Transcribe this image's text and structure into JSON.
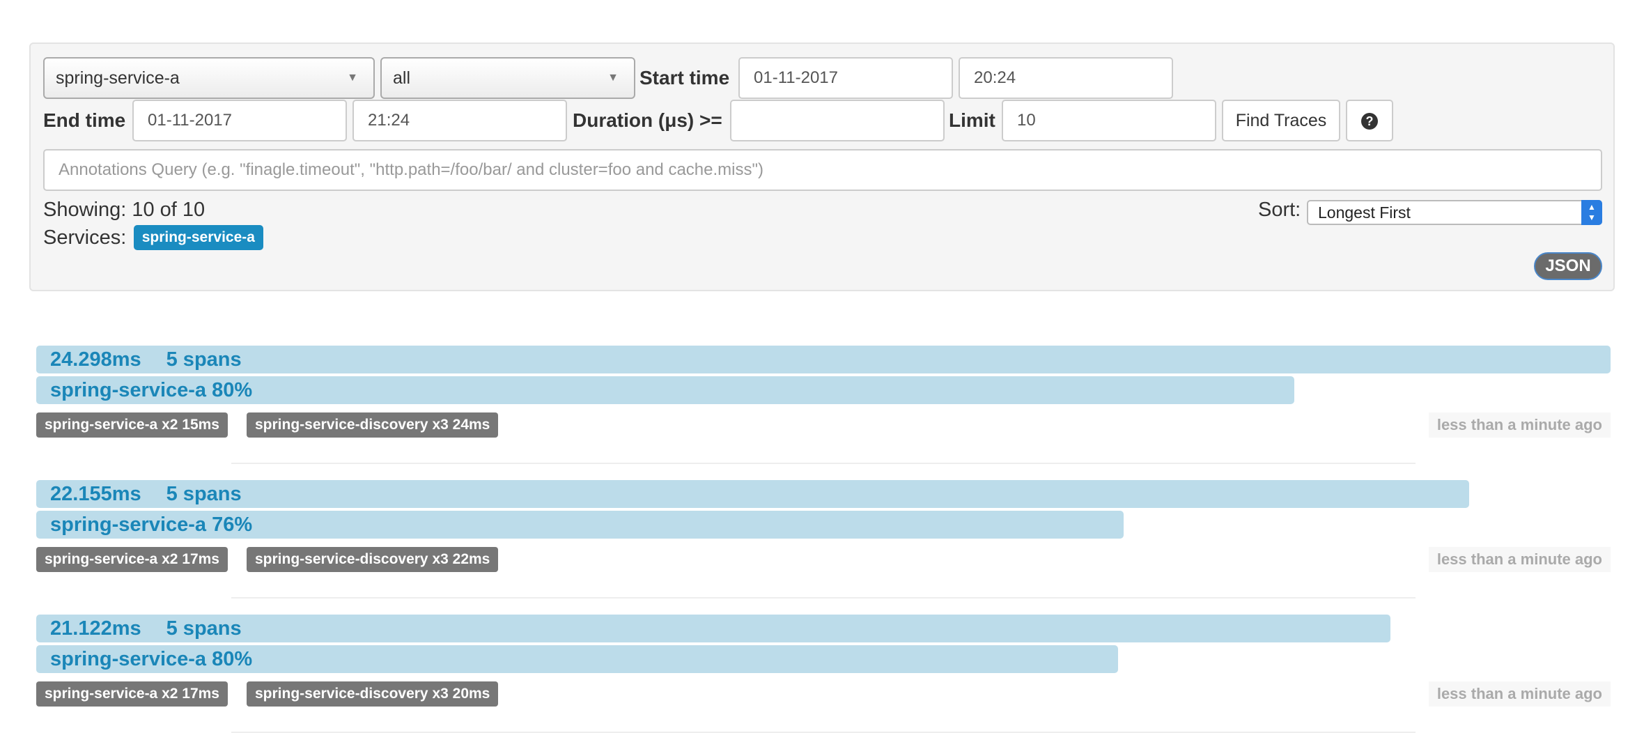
{
  "search": {
    "service_select": "spring-service-a",
    "span_select": "all",
    "start_time_label": "Start time",
    "start_date": "01-11-2017",
    "start_time": "20:24",
    "end_time_label": "End time",
    "end_date": "01-11-2017",
    "end_time": "21:24",
    "duration_label": "Duration (μs) >=",
    "duration_value": "",
    "limit_label": "Limit",
    "limit_value": "10",
    "find_button": "Find Traces",
    "help_icon": "question-circle-icon",
    "annotations_placeholder": "Annotations Query (e.g. \"finagle.timeout\", \"http.path=/foo/bar/ and cluster=foo and cache.miss\")"
  },
  "summary": {
    "showing_label": "Showing: 10 of 10",
    "services_label": "Services:",
    "service_badge": "spring-service-a",
    "sort_label": "Sort:",
    "sort_value": "Longest First",
    "json_button": "JSON"
  },
  "colors": {
    "bar": "#bcdcea",
    "bar_text": "#1a86b8",
    "badge": "#1a8cc1",
    "tag": "#777777"
  },
  "traces": [
    {
      "duration": "24.298ms",
      "spans": "5 spans",
      "duration_fraction": 1.0,
      "service_line": "spring-service-a 80%",
      "service_percent": 80,
      "tags": [
        "spring-service-a x2 15ms",
        "spring-service-discovery x3 24ms"
      ],
      "time_ago": "less than a minute ago"
    },
    {
      "duration": "22.155ms",
      "spans": "5 spans",
      "duration_fraction": 0.91,
      "service_line": "spring-service-a 76%",
      "service_percent": 76,
      "tags": [
        "spring-service-a x2 17ms",
        "spring-service-discovery x3 22ms"
      ],
      "time_ago": "less than a minute ago"
    },
    {
      "duration": "21.122ms",
      "spans": "5 spans",
      "duration_fraction": 0.86,
      "service_line": "spring-service-a 80%",
      "service_percent": 80,
      "tags": [
        "spring-service-a x2 17ms",
        "spring-service-discovery x3 20ms"
      ],
      "time_ago": "less than a minute ago"
    }
  ]
}
